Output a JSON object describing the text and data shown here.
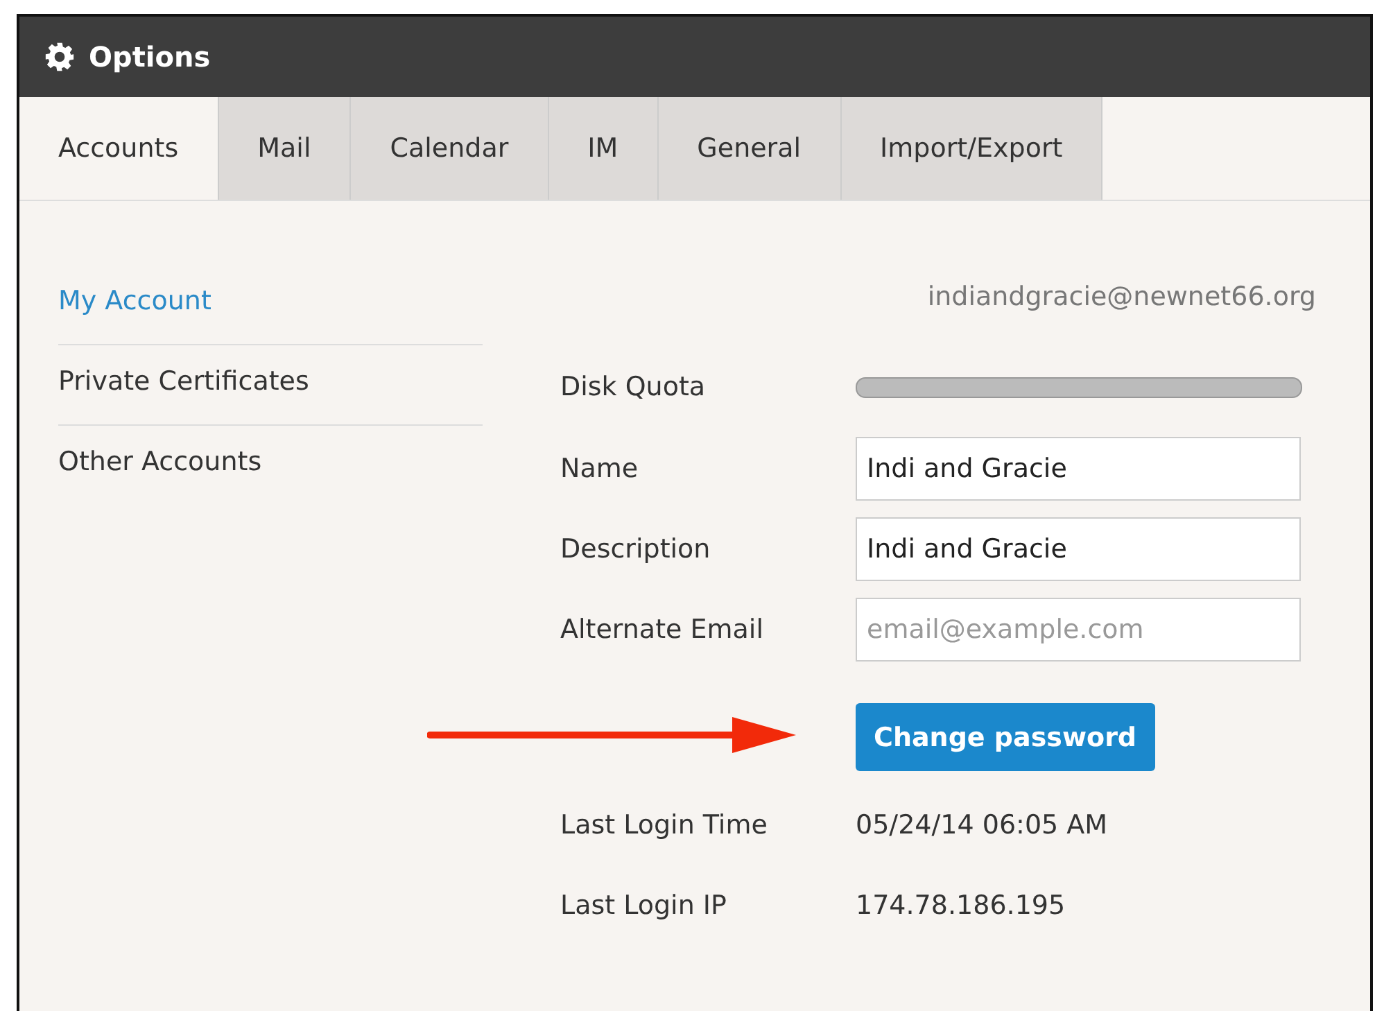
{
  "window": {
    "title": "Options"
  },
  "tabs": [
    {
      "label": "Accounts",
      "selected": true
    },
    {
      "label": "Mail",
      "selected": false
    },
    {
      "label": "Calendar",
      "selected": false
    },
    {
      "label": "IM",
      "selected": false
    },
    {
      "label": "General",
      "selected": false
    },
    {
      "label": "Import/Export",
      "selected": false
    }
  ],
  "sidebar": {
    "items": [
      {
        "label": "My Account",
        "selected": true
      },
      {
        "label": "Private Certificates",
        "selected": false
      },
      {
        "label": "Other Accounts",
        "selected": false
      }
    ]
  },
  "account": {
    "email": "indiandgracie@newnet66.org",
    "disk_quota": {
      "label": "Disk Quota",
      "level": 0
    },
    "fields": [
      {
        "label": "Name",
        "value": "Indi and Gracie"
      },
      {
        "label": "Description",
        "value": "Indi and Gracie"
      },
      {
        "label": "Alternate Email",
        "placeholder": "email@example.com"
      }
    ],
    "change_password_button": "Change password",
    "info": [
      {
        "label": "Last Login Time",
        "value": "05/24/14 06:05 AM"
      },
      {
        "label": "Last Login IP",
        "value": "174.78.186.195"
      }
    ]
  }
}
